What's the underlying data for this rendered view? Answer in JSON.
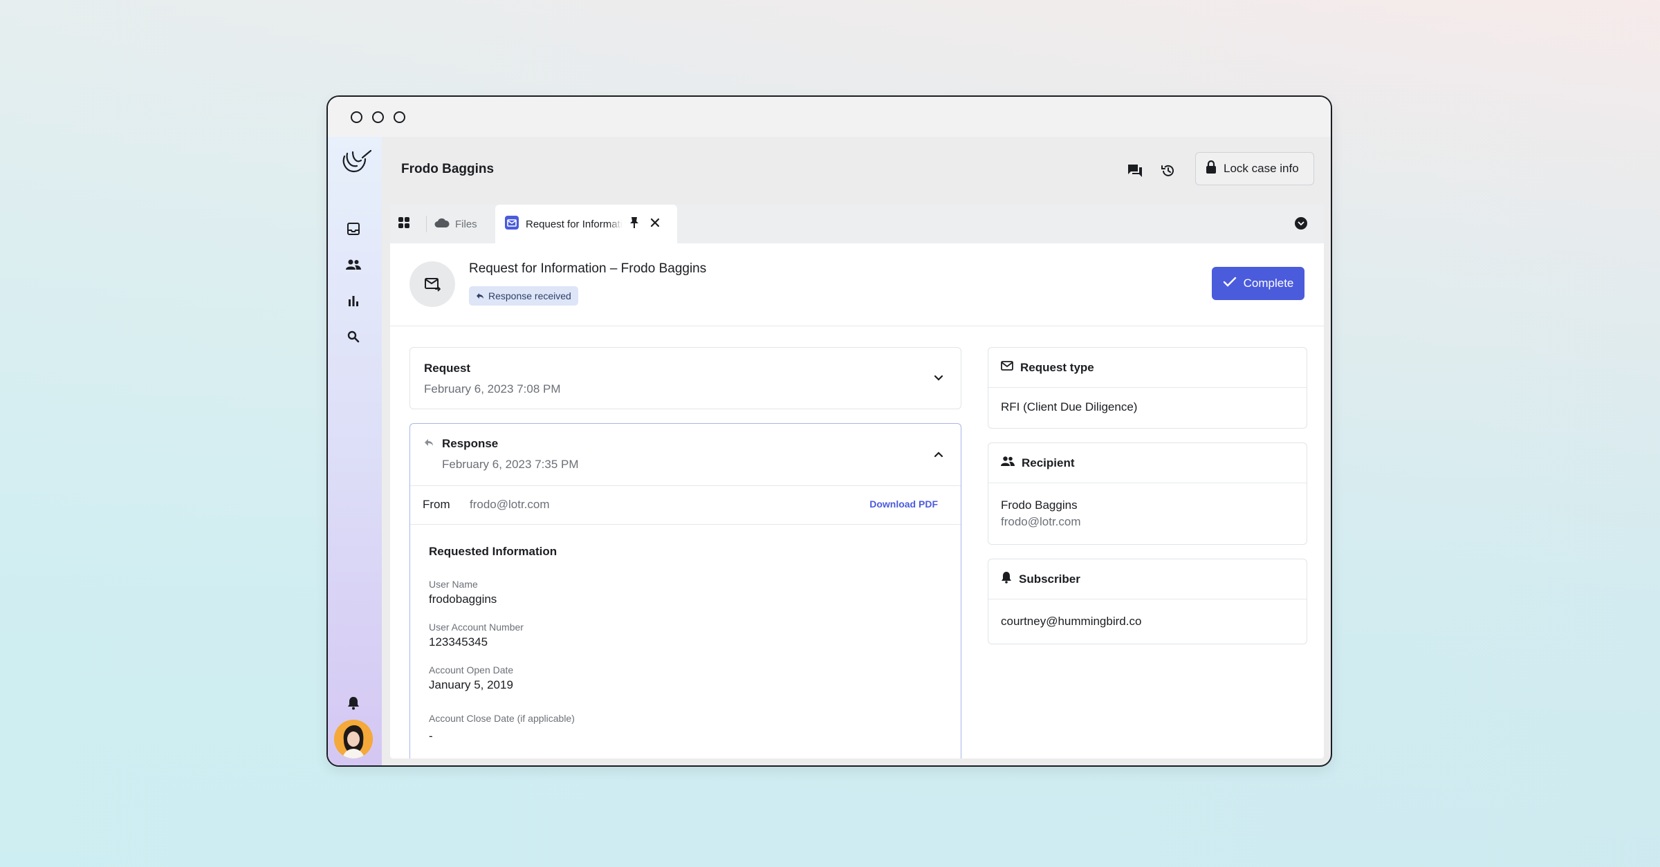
{
  "case": {
    "title": "Frodo Baggins",
    "lock_label": "Lock case info"
  },
  "tabs": {
    "files_label": "Files",
    "active_label": "Request for Information – Frodo Baggins"
  },
  "rfi": {
    "title": "Request for Information – Frodo Baggins",
    "status_badge": "Response received",
    "complete_label": "Complete"
  },
  "request": {
    "title": "Request",
    "date": "February 6, 2023 7:08 PM"
  },
  "response": {
    "title": "Response",
    "date": "February 6, 2023 7:35 PM",
    "from_label": "From",
    "from_value": "frodo@lotr.com",
    "download_label": "Download PDF",
    "section_title": "Requested Information",
    "fields": [
      {
        "label": "User Name",
        "value": "frodobaggins"
      },
      {
        "label": "User Account Number",
        "value": "123345345"
      },
      {
        "label": "Account Open Date",
        "value": "January 5, 2019"
      },
      {
        "label": "Account Close Date (if applicable)",
        "value": "-"
      }
    ]
  },
  "request_type": {
    "title": "Request type",
    "value": "RFI (Client Due Diligence)"
  },
  "recipient": {
    "title": "Recipient",
    "name": "Frodo Baggins",
    "email": "frodo@lotr.com"
  },
  "subscriber": {
    "title": "Subscriber",
    "email": "courtney@hummingbird.co"
  },
  "colors": {
    "accent": "#4a5bdc",
    "badge_bg": "#dde5f7",
    "avatar_bg": "#f4a93a"
  }
}
